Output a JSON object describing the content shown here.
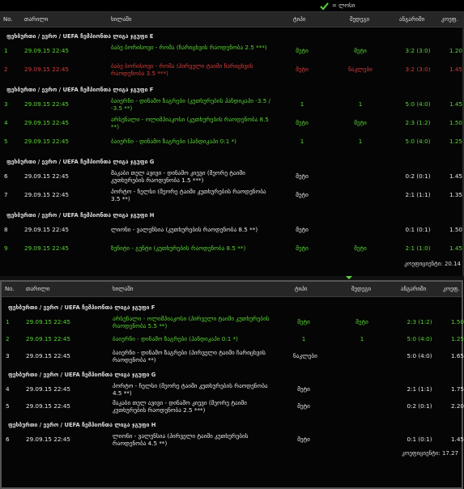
{
  "legend": {
    "check_icon": "check-icon",
    "label": "= ლოსი"
  },
  "columns": {
    "no": "No.",
    "date": "თარილი",
    "game": "ხილაში",
    "pick": "ტიპი",
    "result": "შედეგი",
    "score": "ანგარიში",
    "odds": "კოეფ."
  },
  "columns2": {
    "no": "No.",
    "date": "თარილი",
    "game": "ხილაში",
    "pick": "ტიპი",
    "result": "შედეგი",
    "score": "ანგარიში",
    "odds": "კოეფ."
  },
  "colors": {
    "win": "#59d634",
    "loss": "#d93c3c",
    "pending": "#e8e8e8"
  },
  "panel1": {
    "groups": [
      {
        "title": "ფეხბურთი / ევრო / UEFA ჩემპიონთა ლიგა ჯგუფი E",
        "rows": [
          {
            "no": "1",
            "date": "29.09.15 22:45",
            "game": "ბაბე ბორისოვი - რომა (ჩარიცხვის რაოდენობა 2.5 ***)",
            "pick": "მეტი",
            "result": "მეტი",
            "score": "3:2 (3:0)",
            "odds": "1.20",
            "status": "win"
          },
          {
            "no": "2",
            "date": "29.09.15 22:45",
            "game": "ბაბე ბორისოვი - რომა (პირველი ტაიმი ჩარიცხვის რაოდენობა 3.5 ***)",
            "pick": "მეტი",
            "result": "ნაკლები",
            "score": "3:2 (3:0)",
            "odds": "1.45",
            "status": "loss"
          }
        ]
      },
      {
        "title": "ფეხბურთი / ევრო / UEFA ჩემპიონთა ლიგა ჯგუფი F",
        "rows": [
          {
            "no": "3",
            "date": "29.09.15 22:45",
            "game": "ბაიერნი - დინამო ზაგრები (კუთხურების ჰანდიკაპი -3.5 / -3.5 **)",
            "pick": "1",
            "result": "1",
            "score": "5:0 (4:0)",
            "odds": "1.45",
            "status": "win"
          },
          {
            "no": "4",
            "date": "29.09.15 22:45",
            "game": "არსენალი - ოლიმპიაკოსი (კუთხურების რაოდენობა 8.5 **)",
            "pick": "მეტი",
            "result": "მეტი",
            "score": "2:3 (1:2)",
            "odds": "1.50",
            "status": "win"
          },
          {
            "no": "5",
            "date": "29.09.15 22:45",
            "game": "ბაიერნი - დინამო ზაგრები (ჰანდიკაპი 0:1 *)",
            "pick": "1",
            "result": "1",
            "score": "5:0 (4:0)",
            "odds": "1.25",
            "status": "win"
          }
        ]
      },
      {
        "title": "ფეხბურთი / ევრო / UEFA ჩემპიონთა ლიგა ჯგუფი G",
        "rows": [
          {
            "no": "6",
            "date": "29.09.15 22:45",
            "game": "მაკაბი თელ ავივი - დინამო კიევი (მეორე ტაიმი კუთხურების რაოდენობა 1.5 ***)",
            "pick": "მეტი",
            "result": "",
            "score": "0:2 (0:1)",
            "odds": "1.45",
            "status": "pending"
          },
          {
            "no": "7",
            "date": "29.09.15 22:45",
            "game": "პორტო - ჩელსი (მეორე ტაიმი კუთხურების რაოდენობა 3.5 **)",
            "pick": "მეტი",
            "result": "",
            "score": "2:1 (1:1)",
            "odds": "1.35",
            "status": "pending"
          }
        ]
      },
      {
        "title": "ფეხბურთი / ევრო / UEFA ჩემპიონთა ლიგა ჯგუფი H",
        "rows": [
          {
            "no": "8",
            "date": "29.09.15 22:45",
            "game": "ლიონი - ვალენსია (კუთხურების რაოდენობა 8.5 **)",
            "pick": "მეტი",
            "result": "",
            "score": "0:1 (0:1)",
            "odds": "1.50",
            "status": "pending"
          },
          {
            "no": "9",
            "date": "29.09.15 22:45",
            "game": "ზენიტი - გენტი (კუთხურების რაოდენობა 8.5 **)",
            "pick": "მეტი",
            "result": "მეტი",
            "score": "2:1 (1:0)",
            "odds": "1.45",
            "status": "win"
          }
        ]
      }
    ],
    "total": "კოეფიციენტი: 20.14"
  },
  "panel2": {
    "groups": [
      {
        "title": "ფეხბურთი / ევრო / UEFA ჩემპიონთა ლიგა ჯგუფი F",
        "rows": [
          {
            "no": "1",
            "date": "29.09.15 22:45",
            "game": "არსენალი - ოლიმპიაკოსი (პირველი ტაიმი კუთხურების რაოდენობა 5.5 **)",
            "pick": "მეტი",
            "result": "მეტი",
            "score": "2:3 (1:2)",
            "odds": "1.50",
            "status": "win"
          },
          {
            "no": "2",
            "date": "29.09.15 22:45",
            "game": "ბაიერნი - დინამო ზაგრები (ჰანდიკაპი 0:1 *)",
            "pick": "1",
            "result": "1",
            "score": "5:0 (4:0)",
            "odds": "1.25",
            "status": "win"
          },
          {
            "no": "3",
            "date": "29.09.15 22:45",
            "game": "ბაიერნი - დინამო ზაგრები (პირველი ტაიმი ჩარიცხვის რაოდენობა **)",
            "pick": "ნაკლები",
            "result": "",
            "score": "5:0 (4:0)",
            "odds": "1.65",
            "status": "pending"
          }
        ]
      },
      {
        "title": "ფეხბურთი / ევრო / UEFA ჩემპიონთა ლიგა ჯგუფი G",
        "rows": [
          {
            "no": "4",
            "date": "29.09.15 22:45",
            "game": "პორტო - ჩელსი (მეორე ტაიმი კუთხურების რაოდენობა 4.5 **)",
            "pick": "მეტი",
            "result": "",
            "score": "2:1 (1:1)",
            "odds": "1.75",
            "status": "pending"
          },
          {
            "no": "5",
            "date": "29.09.15 22:45",
            "game": "მაკაბი თელ ავივი - დინამო კიევი (მეორე ტაიმი კუთხურების რაოდენობა 2.5 ***)",
            "pick": "მეტი",
            "result": "",
            "score": "0:2 (0:1)",
            "odds": "2.20",
            "status": "pending"
          }
        ]
      },
      {
        "title": "ფეხბურთი / ევრო / UEFA ჩემპიონთა ლიგა ჯგუფი H",
        "rows": [
          {
            "no": "6",
            "date": "29.09.15 22:45",
            "game": "ლიონი - ვალენსია (პირველი ტაიმი კუთხურების რაოდენობა 4.5 **)",
            "pick": "მეტი",
            "result": "",
            "score": "0:1 (0:1)",
            "odds": "1.45",
            "status": "pending"
          }
        ]
      }
    ],
    "total": "კოეფიციენტი: 17.27"
  }
}
